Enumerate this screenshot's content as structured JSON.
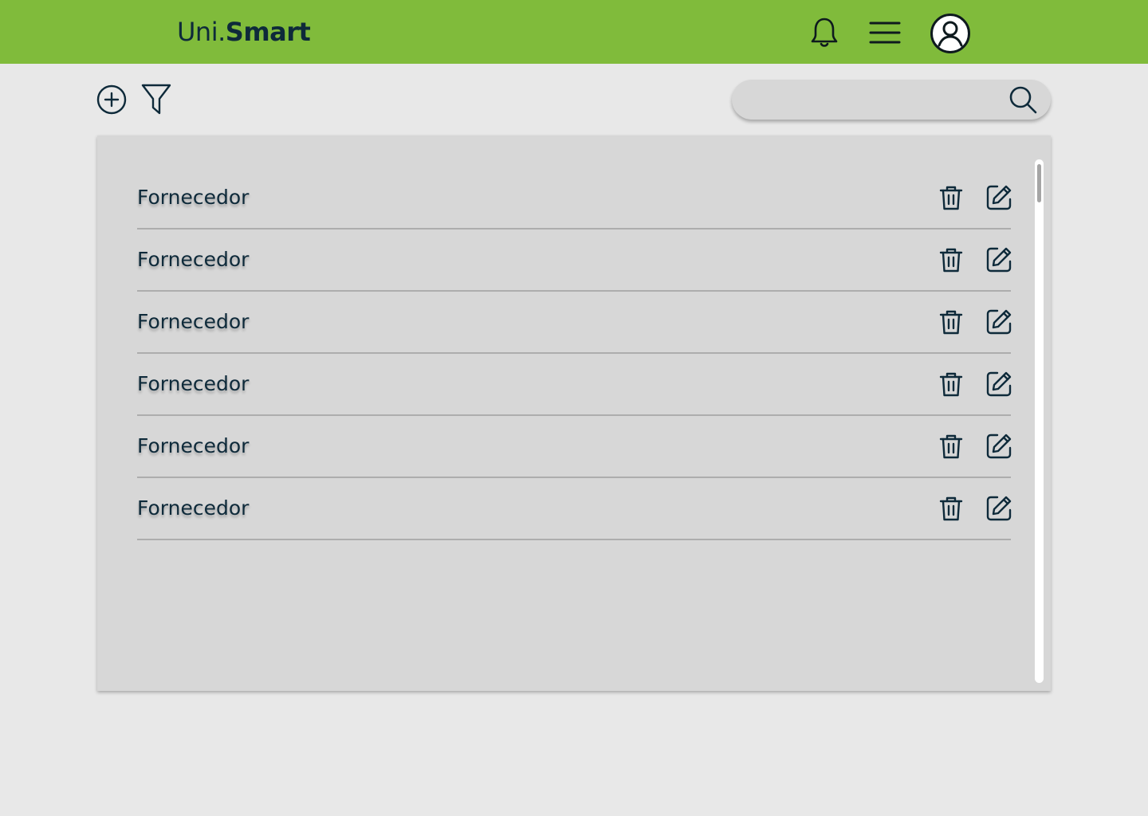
{
  "header": {
    "logo_part1": "Uni.",
    "logo_part2": "Smart",
    "icons": [
      "bell-icon",
      "menu-icon",
      "user-circle-icon"
    ],
    "accent_color": "#80bb3b"
  },
  "toolbar": {
    "icons": [
      "plus-circle-icon",
      "filter-icon"
    ]
  },
  "search": {
    "value": "",
    "placeholder": "",
    "icon": "search-icon"
  },
  "list": {
    "items": [
      {
        "label": "Fornecedor"
      },
      {
        "label": "Fornecedor"
      },
      {
        "label": "Fornecedor"
      },
      {
        "label": "Fornecedor"
      },
      {
        "label": "Fornecedor"
      },
      {
        "label": "Fornecedor"
      }
    ],
    "row_icons": [
      "trash-icon",
      "edit-icon"
    ]
  },
  "colors": {
    "text": "#0e2a3a",
    "background": "#e8e8e8",
    "panel": "#d7d7d7"
  }
}
